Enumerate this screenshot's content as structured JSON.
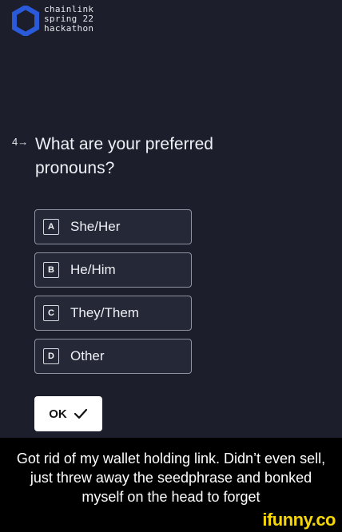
{
  "brand": {
    "line1": "chainlink",
    "line2": "spring 22",
    "line3": "hackathon",
    "icon": "chainlink-hexagon-icon",
    "color": "#2a5ada"
  },
  "question": {
    "number": "4→",
    "text": "What are your preferred pronouns?"
  },
  "options": [
    {
      "key": "A",
      "label": "She/Her"
    },
    {
      "key": "B",
      "label": "He/Him"
    },
    {
      "key": "C",
      "label": "They/Them"
    },
    {
      "key": "D",
      "label": "Other"
    }
  ],
  "ok_button": {
    "label": "OK",
    "icon": "checkmark-icon"
  },
  "caption": "Got rid of my wallet holding link. Didn’t even sell, just threw away the seedphrase and bonked myself on the head to forget",
  "watermark": "ifunny.co",
  "colors": {
    "background": "#1c1f2b",
    "option_border": "#8f93a2",
    "watermark": "#f5d60c"
  }
}
